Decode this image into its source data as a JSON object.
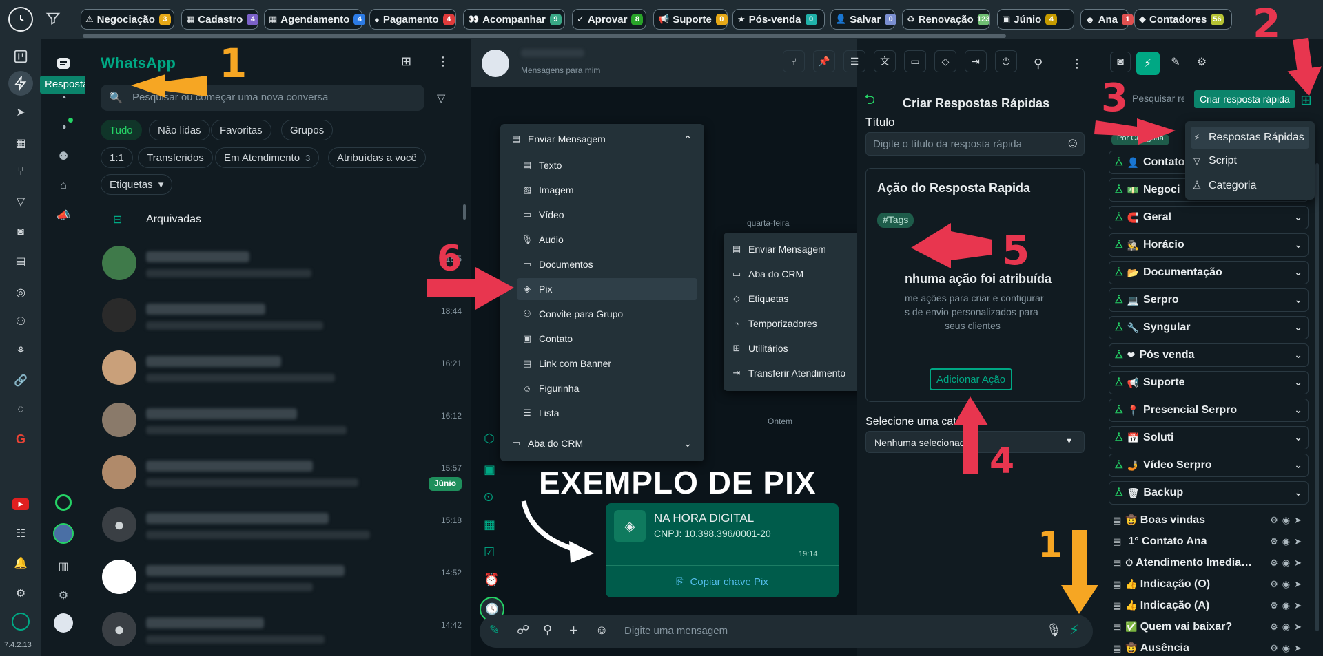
{
  "version": "7.4.2.13",
  "colors": {
    "green": "#00a884",
    "badge_orange": "#f0a31a"
  },
  "tags": [
    {
      "label": "Negociação",
      "icon": "⚠",
      "count": "3",
      "color": "#e6a817"
    },
    {
      "label": "Cadastro",
      "icon": "▦",
      "count": "4",
      "color": "#7b61c9"
    },
    {
      "label": "Agendamento",
      "icon": "▦",
      "count": "4",
      "color": "#2c7be5"
    },
    {
      "label": "Pagamento",
      "icon": "●",
      "count": "4",
      "color": "#e03b3b"
    },
    {
      "label": "Acompanhar",
      "icon": "👀",
      "count": "9",
      "color": "#39a886"
    },
    {
      "label": "Aprovar",
      "icon": "✓",
      "count": "8",
      "color": "#29a329"
    },
    {
      "label": "Suporte",
      "icon": "📢",
      "count": "0",
      "color": "#e6a817"
    },
    {
      "label": "Pós-venda",
      "icon": "★",
      "count": "0",
      "color": "#20b2aa"
    },
    {
      "label": "Salvar",
      "icon": "👤",
      "count": "0",
      "color": "#7b8fd1"
    },
    {
      "label": "Renovação",
      "icon": "♻",
      "count": "123",
      "color": "#6fbf73"
    },
    {
      "label": "Júnio",
      "icon": "▣",
      "count": "4",
      "color": "#c69b00"
    },
    {
      "label": "Ana",
      "icon": "☻",
      "count": "1",
      "color": "#e05050"
    },
    {
      "label": "Contadores",
      "icon": "◆",
      "count": "56",
      "color": "#b5c233"
    }
  ],
  "tooltip_left": "Resposta rápida",
  "chatlist": {
    "title": "WhatsApp",
    "search_placeholder": "Pesquisar ou começar uma nova conversa",
    "filters1": [
      "Tudo",
      "Não lidas",
      "Favoritas",
      "Grupos"
    ],
    "filters2": [
      "1:1",
      "Transferidos",
      "Em Atendimento",
      "Atribuídas a você"
    ],
    "in_attendance_count": "3",
    "etiquetas": "Etiquetas",
    "archived": "Arquivadas",
    "times": [
      "18:5",
      "18:44",
      "16:21",
      "16:12",
      "15:57",
      "15:18",
      "14:52",
      "14:42"
    ],
    "junio_badge": "Júnio"
  },
  "chat": {
    "subtitle": "Mensagens para mim",
    "day1": "quarta-feira",
    "day2": "Ontem",
    "pix_example": "EXEMPLO DE PIX",
    "pix_name": "NA HORA DIGITAL",
    "pix_cnpj": "CNPJ: 10.398.396/0001-20",
    "pix_time": "19:14",
    "pix_copy": "Copiar chave Pix",
    "composer_placeholder": "Digite uma mensagem"
  },
  "menu1": {
    "header": "Enviar Mensagem",
    "items": [
      "Texto",
      "Imagem",
      "Vídeo",
      "Áudio",
      "Documentos",
      "Pix",
      "Convite para Grupo",
      "Contato",
      "Link com Banner",
      "Figurinha",
      "Lista"
    ],
    "footer": "Aba do CRM"
  },
  "menu2": {
    "items": [
      "Enviar Mensagem",
      "Aba do CRM",
      "Etiquetas",
      "Temporizadores",
      "Utilitários",
      "Transferir Atendimento"
    ]
  },
  "form": {
    "title": "Criar Respostas Rápidas",
    "field_title": "Título",
    "title_placeholder": "Digite o título da resposta rápida",
    "action_title": "Ação do Resposta Rapida",
    "tags_chip": "#Tags",
    "no_action": "nhuma ação foi atribuída",
    "desc1": "me ações para criar e configurar",
    "desc2": "s de envio personalizados para",
    "desc3": "seus clientes",
    "add_action": "Adicionar Ação",
    "select_label": "Selecione uma cat",
    "select_value": "Nenhuma selecionad"
  },
  "rsb": {
    "search_placeholder": "Pesquisar resp",
    "tooltip": "Criar resposta rápida",
    "filter_label": "Por Categoria",
    "dropdown": [
      "Respostas Rápidas",
      "Script",
      "Categoria"
    ],
    "categories": [
      {
        "label": "Contato",
        "icon": "👤"
      },
      {
        "label": "Negoci",
        "icon": "💵"
      },
      {
        "label": "Geral",
        "icon": "🧲"
      },
      {
        "label": "Horácio",
        "icon": "🕵"
      },
      {
        "label": "Documentação",
        "icon": "📂"
      },
      {
        "label": "Serpro",
        "icon": "💻"
      },
      {
        "label": "Syngular",
        "icon": "🔧"
      },
      {
        "label": "Pós venda",
        "icon": "❤"
      },
      {
        "label": "Suporte",
        "icon": "📢"
      },
      {
        "label": "Presencial Serpro",
        "icon": "📍"
      },
      {
        "label": "Soluti",
        "icon": "📅"
      },
      {
        "label": "Vídeo Serpro",
        "icon": "🤳"
      },
      {
        "label": "Backup",
        "icon": "🗑"
      }
    ],
    "replies": [
      {
        "label": "Boas vindas",
        "icon": "🤠"
      },
      {
        "label": "1° Contato Ana",
        "icon": ""
      },
      {
        "label": "Atendimento Imedia…",
        "icon": "⏱"
      },
      {
        "label": "Indicação (O)",
        "icon": "👍"
      },
      {
        "label": "Indicação (A)",
        "icon": "👍"
      },
      {
        "label": "Quem vai baixar?",
        "icon": "✅"
      },
      {
        "label": "Ausência",
        "icon": "🤠"
      }
    ]
  },
  "annotations": [
    "1",
    "2",
    "3",
    "4",
    "5",
    "6",
    "1"
  ]
}
